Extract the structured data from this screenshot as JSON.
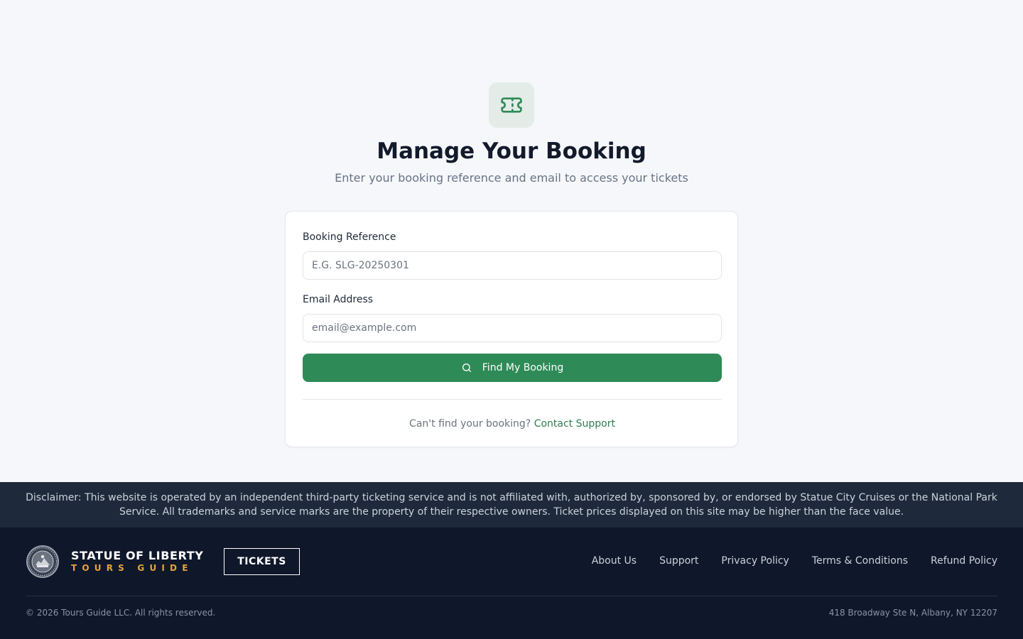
{
  "hero": {
    "icon": "ticket-icon",
    "title": "Manage Your Booking",
    "subtitle": "Enter your booking reference and email to access your tickets"
  },
  "form": {
    "reference_label": "Booking Reference",
    "reference_placeholder": "E.G. SLG-20250301",
    "reference_value": "",
    "email_label": "Email Address",
    "email_placeholder": "email@example.com",
    "email_value": "",
    "submit_icon": "search-icon",
    "submit_label": "Find My Booking",
    "help_text": "Can't find your booking?",
    "help_link": "Contact Support"
  },
  "disclaimer": {
    "text": "Disclaimer: This website is operated by an independent third-party ticketing service and is not affiliated with, authorized by, sponsored by, or endorsed by Statue City Cruises or the National Park Service. All trademarks and service marks are the property of their respective owners. Ticket prices displayed on this site may be higher than the face value."
  },
  "footer": {
    "brand_title": "STATUE OF LIBERTY",
    "brand_subtitle": "TOURS GUIDE",
    "tickets_button": "TICKETS",
    "links": [
      "About Us",
      "Support",
      "Privacy Policy",
      "Terms & Conditions",
      "Refund Policy"
    ],
    "copyright": "© 2026 Tours Guide LLC. All rights reserved.",
    "address": "418 Broadway Ste N, Albany, NY 12207"
  },
  "colors": {
    "primary": "#2e8b57",
    "link": "#2e7d4f",
    "accent": "#e8a33c",
    "footer_bg": "#0f172a",
    "disclaimer_bg": "#1e293b",
    "page_bg": "#f5f7fa"
  }
}
